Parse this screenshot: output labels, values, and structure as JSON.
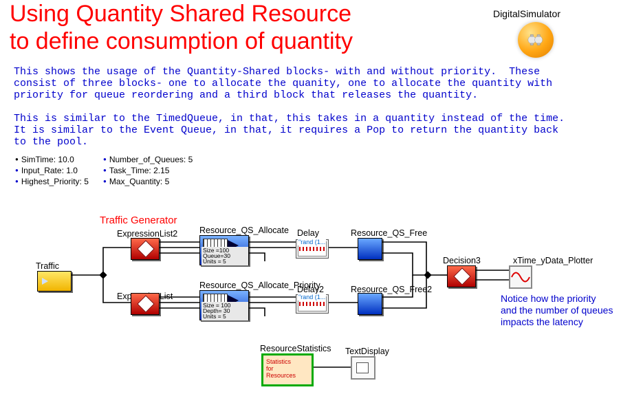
{
  "title_line1": "Using Quantity Shared Resource",
  "title_line2": "to define consumption of quantity",
  "brand": "DigitalSimulator",
  "description_p1": "This shows the usage of the Quantity-Shared blocks- with and without priority.  These\nconsist of three blocks- one to allocate the quanity, one to allocate the quantity with\npriority for queue reordering and a third block that releases the quantity.",
  "description_p2": "This is similar to the TimedQueue, in that, this takes in a quantity instead of the time.\nIt is similar to the Event Queue, in that, it requires a Pop to return the quantity back\nto the pool.",
  "params": {
    "col1": [
      {
        "bullet": "black",
        "label": "SimTime",
        "value": "10.0"
      },
      {
        "bullet": "blue",
        "label": "Input_Rate",
        "value": "1.0"
      },
      {
        "bullet": "blue",
        "label": "Highest_Priority",
        "value": "5"
      }
    ],
    "col2": [
      {
        "bullet": "blue",
        "label": "Number_of_Queues",
        "value": "5"
      },
      {
        "bullet": "blue",
        "label": "Task_Time",
        "value": "2.15"
      },
      {
        "bullet": "blue",
        "label": "Max_Quantity",
        "value": "5"
      }
    ]
  },
  "section_title": "Traffic Generator",
  "blocks": {
    "traffic": "Traffic",
    "expr_top": "ExpressionList2",
    "expr_bot": "ExpressionList",
    "alloc_top": "Resource_QS_Allocate",
    "alloc_bot": "Resource_QS_Allocate_Priority",
    "alloc_top_txt": "Size =100\nQueue=30\nUnits = 5",
    "alloc_bot_txt": "Size = 100\nDepth= 30\nUnits = 5",
    "delay1": "Delay",
    "delay2": "Delay2",
    "delay_rand": "\"rand (1...",
    "free1": "Resource_QS_Free",
    "free2": "Resource_QS_Free2",
    "decision": "Decision3",
    "plotter": "xTime_yData_Plotter",
    "stats": "ResourceStatistics",
    "stats_inner": "Statistics\nfor\nResources",
    "textdisp": "TextDisplay"
  },
  "note": "Notice how the priority\nand the number of queues\nimpacts the latency"
}
